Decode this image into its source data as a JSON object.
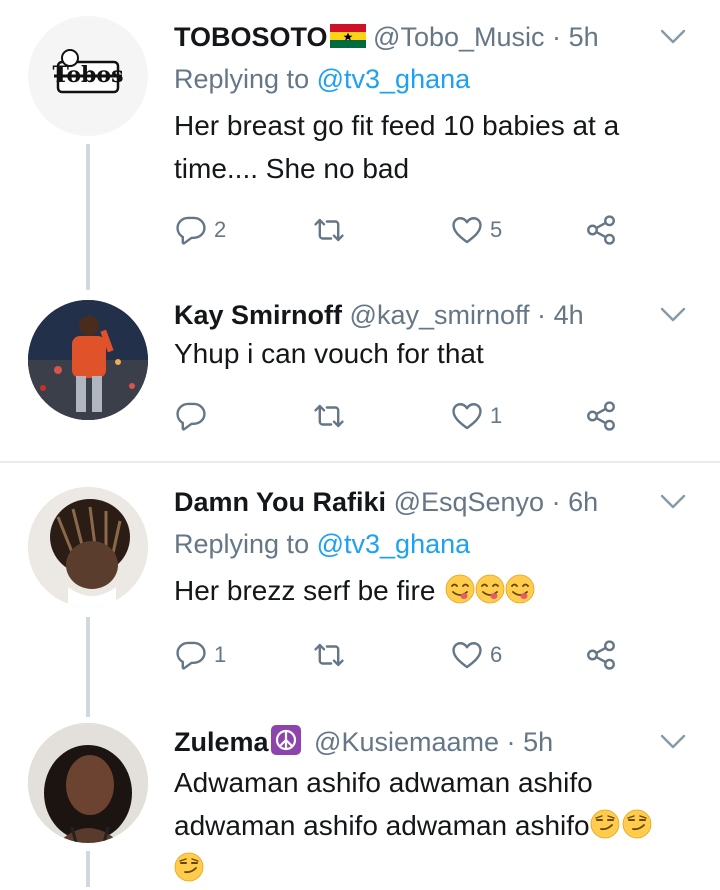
{
  "tweets": [
    {
      "name": "TOBOSOTO",
      "handle": "@Tobo_Music",
      "separator": "·",
      "time": "5h",
      "replying_label": "Replying to",
      "replying_to": "@tv3_ghana",
      "text": "Her breast go fit feed 10 babies at a time.... She no bad",
      "reply_count": "2",
      "retweet_count": "",
      "like_count": "5",
      "avatar_logo_text": "Tobos"
    },
    {
      "name": "Kay Smirnoff",
      "handle": "@kay_smirnoff",
      "separator": "·",
      "time": "4h",
      "text": "Yhup i can vouch for that",
      "reply_count": "",
      "retweet_count": "",
      "like_count": "1"
    },
    {
      "name": "Damn You Rafiki",
      "handle": "@EsqSenyo",
      "separator": "·",
      "time": "6h",
      "replying_label": "Replying to",
      "replying_to": "@tv3_ghana",
      "text": "Her brezz serf be fire",
      "reply_count": "1",
      "retweet_count": "",
      "like_count": "6"
    },
    {
      "name": "Zulema",
      "handle": "@Kusiemaame",
      "separator": "·",
      "time": "5h",
      "text_line1": "Adwaman ashifo adwaman ashifo",
      "text_line2": "adwaman ashifo adwaman ashifo"
    }
  ],
  "icons": {
    "reply": "reply-icon",
    "retweet": "retweet-icon",
    "like": "heart-icon",
    "share": "share-icon",
    "more": "chevron-down-icon"
  },
  "colors": {
    "text": "#14171a",
    "secondary": "#657786",
    "link": "#1da1f2",
    "thread": "#cfd8de",
    "divider": "#e6ecf0"
  }
}
